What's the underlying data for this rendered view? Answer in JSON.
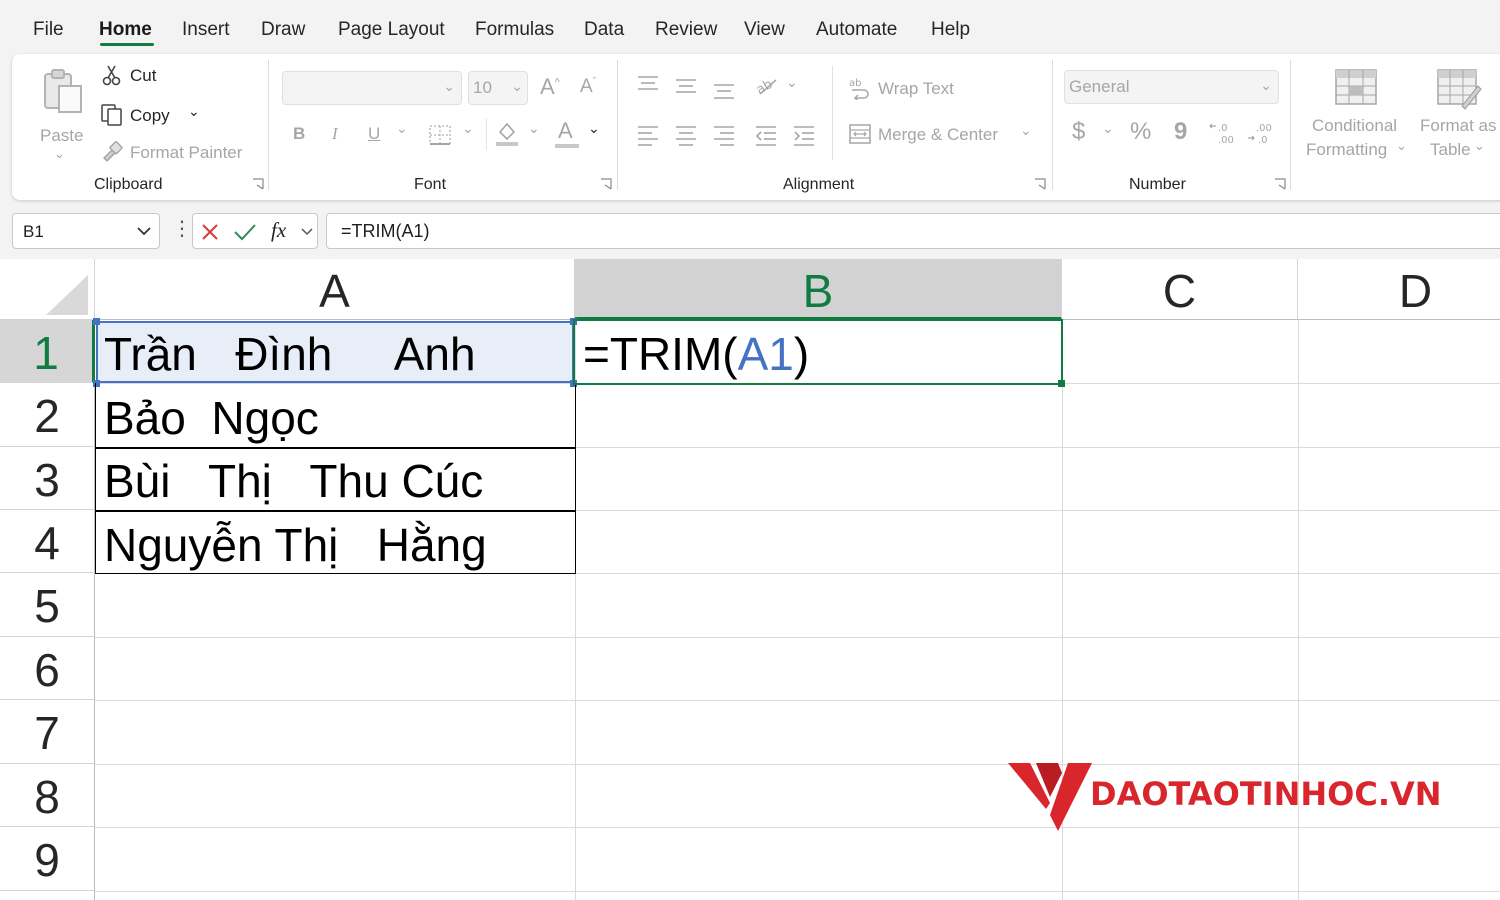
{
  "menu": {
    "tabs": [
      {
        "label": "File"
      },
      {
        "label": "Home"
      },
      {
        "label": "Insert"
      },
      {
        "label": "Draw"
      },
      {
        "label": "Page Layout"
      },
      {
        "label": "Formulas"
      },
      {
        "label": "Data"
      },
      {
        "label": "Review"
      },
      {
        "label": "View"
      },
      {
        "label": "Automate"
      },
      {
        "label": "Help"
      }
    ],
    "active": "Home"
  },
  "ribbon": {
    "clipboard": {
      "paste": "Paste",
      "cut": "Cut",
      "copy": "Copy",
      "format_painter": "Format Painter",
      "label": "Clipboard"
    },
    "font": {
      "size": "10",
      "bold": "B",
      "italic": "I",
      "underline": "U",
      "font_color_glyph": "A",
      "label": "Font"
    },
    "alignment": {
      "wrap_text": "Wrap Text",
      "merge_center": "Merge & Center",
      "label": "Alignment"
    },
    "number": {
      "format": "General",
      "currency": "$",
      "percent": "%",
      "comma": "9",
      "label": "Number"
    },
    "styles": {
      "conditional_line1": "Conditional",
      "conditional_line2": "Formatting",
      "format_table_line1": "Format as",
      "format_table_line2": "Table"
    }
  },
  "formula_bar": {
    "name_box": "B1",
    "fx": "fx",
    "formula": "=TRIM(A1)"
  },
  "sheet": {
    "columns": [
      "A",
      "B",
      "C",
      "D"
    ],
    "rows": [
      "1",
      "2",
      "3",
      "4",
      "5",
      "6",
      "7",
      "8",
      "9"
    ],
    "selected_cell": "B1",
    "cells": {
      "A1": "Trần   Đình     Anh",
      "A2": "Bảo  Ngọc",
      "A3": "Bùi   Thị   Thu Cúc",
      "A4": "Nguyễn Thị   Hằng",
      "B1_prefix": "=TRIM(",
      "B1_ref": "A1",
      "B1_suffix": ")"
    }
  },
  "watermark": {
    "text": "DAOTAOTINHOC.VN"
  },
  "colors": {
    "accent": "#107c41",
    "reference": "#4472c4",
    "watermark": "#d9262c"
  }
}
